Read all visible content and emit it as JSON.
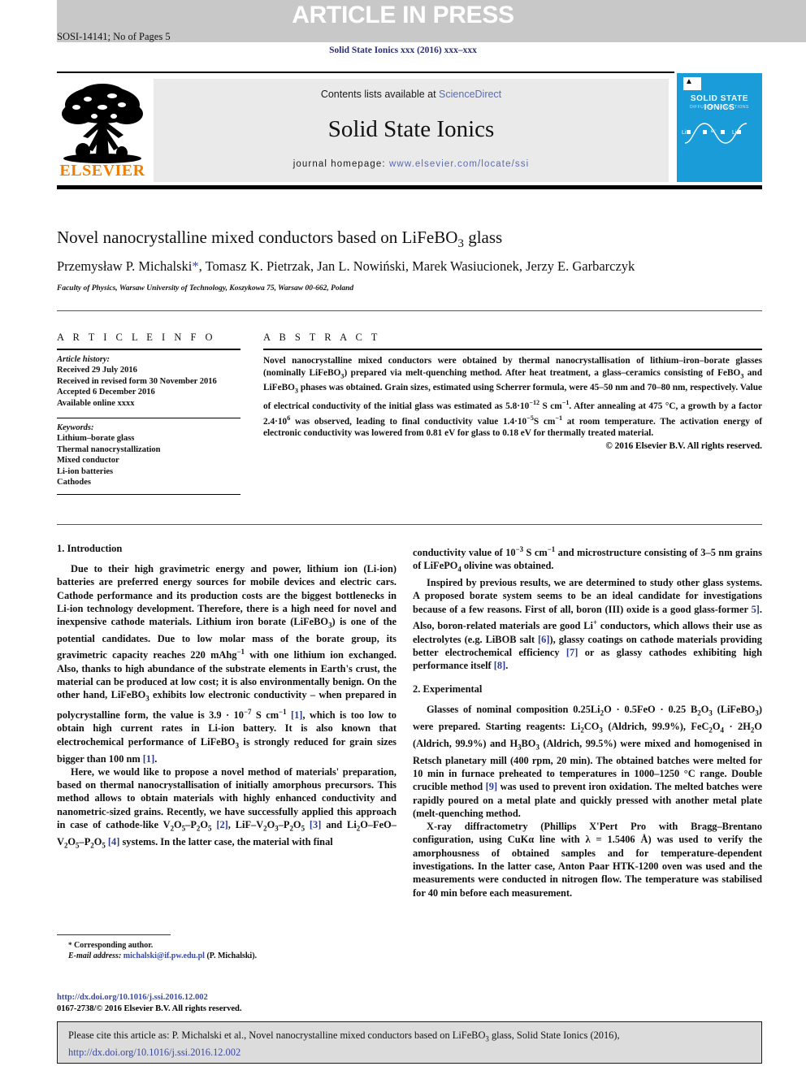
{
  "banner": {
    "article_in_press": "ARTICLE IN PRESS",
    "sosi_line": "SOSI-14141; No of Pages 5"
  },
  "running_head": "Solid State Ionics xxx (2016) xxx–xxx",
  "masthead": {
    "contents_prefix": "Contents lists available at ",
    "sciencedirect": "ScienceDirect",
    "journal_title": "Solid State Ionics",
    "homepage_prefix": "journal homepage: ",
    "homepage_url": "www.elsevier.com/locate/ssi",
    "publisher": "ELSEVIER",
    "cover_title": "SOLID STATE IONICS",
    "cover_subtitle": "DIFFUSION & REACTIONS",
    "accent_orange": "#ef7d00",
    "cover_blue": "#1a9cd8",
    "link_blue": "#5a6ab5"
  },
  "article": {
    "title_html": "Novel nanocrystalline mixed conductors based on LiFeBO<sub>3</sub> glass",
    "authors_html": "Przemysław P. Michalski<span class=\"star\">*</span>, Tomasz K. Pietrzak, Jan L. Nowiński, Marek Wasiucionek, Jerzy E. Garbarczyk",
    "affiliation": "Faculty of Physics, Warsaw University of Technology, Koszykowa 75, Warsaw 00-662, Poland"
  },
  "article_info": {
    "heading": "A R T I C L E   I N F O",
    "history_label": "Article history:",
    "history": [
      "Received 29 July 2016",
      "Received in revised form 30 November 2016",
      "Accepted 6 December 2016",
      "Available online xxxx"
    ],
    "keywords_label": "Keywords:",
    "keywords": [
      "Lithium–borate glass",
      "Thermal nanocrystallization",
      "Mixed conductor",
      "Li-ion batteries",
      "Cathodes"
    ]
  },
  "abstract": {
    "heading": "A B S T R A C T",
    "body_html": "Novel nanocrystalline mixed conductors were obtained by thermal nanocrystallisation of lithium–iron–borate glasses (nominally LiFeBO<sub>3</sub>) prepared via melt-quenching method. After heat treatment, a glass–ceramics consisting of FeBO<sub>3</sub> and LiFeBO<sub>3</sub> phases was obtained. Grain sizes, estimated using Scherrer formula, were 45–50 nm and 70–80 nm, respectively. Value of electrical conductivity of the initial glass was estimated as 5.8·10<sup>−12</sup> S cm<sup>−1</sup>. After annealing at 475 °C, a growth by a factor 2.4·10<sup>6</sup> was observed, leading to final conductivity value 1.4·10<sup>−5</sup>S cm<sup>−1</sup> at room temperature. The activation energy of electronic conductivity was lowered from 0.81 eV for glass to 0.18 eV for thermally treated material.",
    "copyright": "© 2016 Elsevier B.V. All rights reserved."
  },
  "sections": {
    "introduction": {
      "heading": "1. Introduction",
      "paragraphs_html": [
        "Due to their high gravimetric energy and power, lithium ion (Li-ion) batteries are preferred energy sources for mobile devices and electric cars. Cathode performance and its production costs are the biggest bottlenecks in Li-ion technology development. Therefore, there is a high need for novel and inexpensive cathode materials. Lithium iron borate (LiFeBO<sub>3</sub>) is one of the potential candidates. Due to low molar mass of the borate group, its gravimetric capacity reaches 220 mAhg<sup>−1</sup> with one lithium ion exchanged. Also, thanks to high abundance of the substrate elements in Earth's crust, the material can be produced at low cost; it is also environmentally benign. On the other hand, LiFeBO<sub>3</sub> exhibits low electronic conductivity – when prepared in polycrystalline form, the value is 3.9 · 10<sup>−7</sup> S cm<sup>−1</sup> <span class=\"ref\">[1]</span>, which is too low to obtain high current rates in Li-ion battery. It is also known that electrochemical performance of LiFeBO<sub>3</sub> is strongly reduced for grain sizes bigger than 100 nm <span class=\"ref\">[1]</span>.",
        "Here, we would like to propose a novel method of materials' preparation, based on thermal nanocrystallisation of initially amorphous precursors. This method allows to obtain materials with highly enhanced conductivity and nanometric-sized grains. Recently, we have successfully applied this approach in case of cathode-like V<sub>2</sub>O<sub>5</sub>–P<sub>2</sub>O<sub>5</sub> <span class=\"ref\">[2]</span>, LiF–V<sub>2</sub>O<sub>3</sub>–P<sub>2</sub>O<sub>5</sub> <span class=\"ref\">[3]</span> and Li<sub>2</sub>O–FeO–V<sub>2</sub>O<sub>5</sub>–P<sub>2</sub>O<sub>5</sub> <span class=\"ref\">[4]</span> systems. In the latter case, the material with final",
        "conductivity value of 10<sup>−3</sup> S cm<sup>−1</sup> and microstructure consisting of 3–5 nm grains of LiFePO<sub>4</sub> olivine was obtained.",
        "Inspired by previous results, we are determined to study other glass systems. A proposed borate system seems to be an ideal candidate for investigations because of a few reasons. First of all, boron (III) oxide is a good glass-former <span class=\"ref\">5]</span>. Also, boron-related materials are good Li<sup>+</sup> conductors, which allows their use as electrolytes (e.g. LiBOB salt <span class=\"ref\">[6]</span>), glassy coatings on cathode materials providing better electrochemical efficiency <span class=\"ref\">[7]</span> or as glassy cathodes exhibiting high performance itself <span class=\"ref\">[8]</span>."
      ]
    },
    "experimental": {
      "heading": "2. Experimental",
      "paragraphs_html": [
        "Glasses of nominal composition 0.25Li<sub>2</sub>O · 0.5FeO · 0.25 B<sub>2</sub>O<sub>3</sub> (LiFeBO<sub>3</sub>) were prepared. Starting reagents: Li<sub>2</sub>CO<sub>3</sub> (Aldrich, 99.9%), FeC<sub>2</sub>O<sub>4</sub> · 2H<sub>2</sub>O (Aldrich, 99.9%) and H<sub>3</sub>BO<sub>3</sub> (Aldrich, 99.5%) were mixed and homogenised in Retsch planetary mill (400 rpm, 20 min). The obtained batches were melted for 10 min in furnace preheated to temperatures in 1000–1250 °C range. Double crucible method <span class=\"ref\">[9]</span> was used to prevent iron oxidation. The melted batches were rapidly poured on a metal plate and quickly pressed with another metal plate (melt-quenching method.",
        "X-ray diffractometry (Phillips X'Pert Pro with Bragg–Brentano configuration, using CuKα line with λ = 1.5406 Å) was used to verify the amorphousness of obtained samples and for temperature-dependent investigations. In the latter case, Anton Paar HTK-1200 oven was used and the measurements were conducted in nitrogen flow. The temperature was stabilised for 40 min before each measurement."
      ]
    }
  },
  "footnote": {
    "corresponding": "Corresponding author.",
    "email_label": "E-mail address:",
    "email": "michalski@if.pw.edu.pl",
    "email_owner": "(P. Michalski).",
    "doi": "http://dx.doi.org/10.1016/j.ssi.2016.12.002",
    "issn_line": "0167-2738/© 2016 Elsevier B.V. All rights reserved."
  },
  "cite_box": {
    "text_html": "Please cite this article as: P. Michalski et al., Novel nanocrystalline mixed conductors based on LiFeBO<sub>3</sub> glass, Solid State Ionics (2016),",
    "doi": "http://dx.doi.org/10.1016/j.ssi.2016.12.002"
  }
}
